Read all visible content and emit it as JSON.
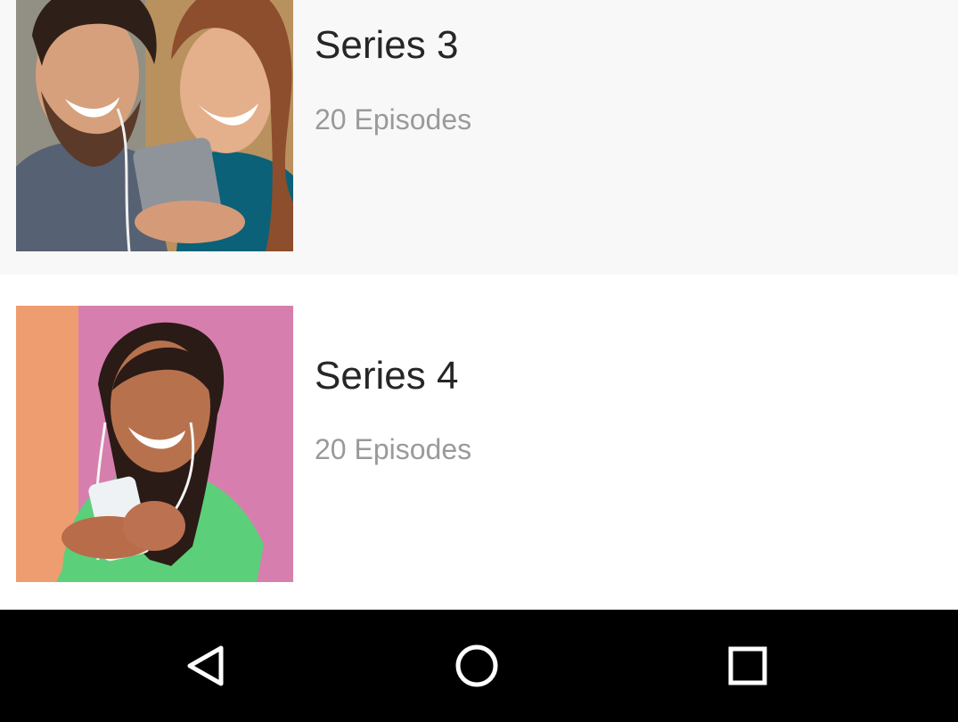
{
  "series_list": {
    "items": [
      {
        "title": "Series 3",
        "subtitle": "20 Episodes",
        "thumbnail_icon": "couple-watching-phone-photo"
      },
      {
        "title": "Series 4",
        "subtitle": "20 Episodes",
        "thumbnail_icon": "woman-with-phone-photo"
      }
    ]
  },
  "navigation_bar": {
    "background": "#000000",
    "buttons": [
      {
        "icon": "back-triangle-icon"
      },
      {
        "icon": "home-circle-icon"
      },
      {
        "icon": "recents-square-icon"
      }
    ]
  },
  "colors": {
    "row_alt_background": "#f8f8f8",
    "title_text": "#262626",
    "subtitle_text": "#9a9a9a"
  }
}
